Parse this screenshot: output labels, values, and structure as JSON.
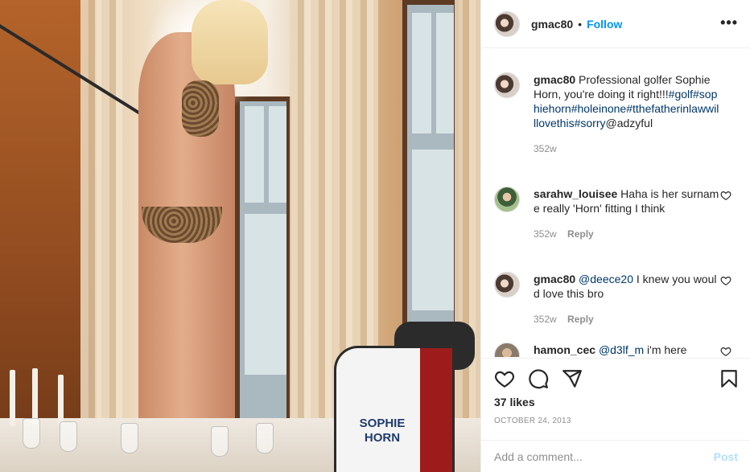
{
  "post": {
    "username": "gmac80",
    "separator": "•",
    "follow_label": "Follow",
    "more_label": "•••"
  },
  "photo": {
    "bag_text_line1": "SOPHIE",
    "bag_text_line2": "HORN"
  },
  "comments": [
    {
      "username": "gmac80",
      "text": " Professional golfer Sophie Horn, you're doing it right!!!",
      "tags": "#golf#sophiehorn#holeinone#tthefatherinlawwilllovethis#sorry",
      "mention": "@adzyful",
      "time": "352w",
      "reply": ""
    },
    {
      "username": "sarahw_louisee",
      "text": " Haha is her surname really 'Horn' fitting I think",
      "time": "352w",
      "reply": "Reply"
    },
    {
      "username": "gmac80",
      "mention": "@deece20",
      "text": " I knew you would love this bro",
      "time": "352w",
      "reply": "Reply"
    },
    {
      "username": "hamon_cec",
      "mention": "@d3lf_m",
      "text": " i'm here"
    }
  ],
  "actions": {
    "likes": "37 likes",
    "date": "OCTOBER 24, 2013"
  },
  "add_comment": {
    "placeholder": "Add a comment...",
    "post_label": "Post"
  },
  "colors": {
    "link_blue": "#0095f6",
    "hashtag": "#00376b",
    "muted": "#8e8e8e",
    "post_disabled": "#b2dffc"
  },
  "icons": [
    "more-icon",
    "heart-icon",
    "comment-icon",
    "share-icon",
    "bookmark-icon"
  ]
}
